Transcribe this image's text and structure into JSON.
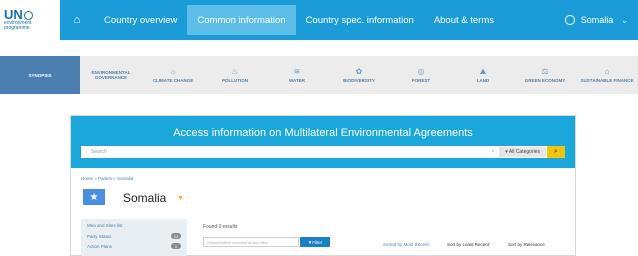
{
  "topnav": {
    "logo_text": "UN",
    "logo_sub_1": "environment",
    "logo_sub_2": "programme",
    "home_icon": "home-icon",
    "items": [
      {
        "label": "Country overview"
      },
      {
        "label": "Common information"
      },
      {
        "label": "Country spec. information"
      },
      {
        "label": "About & terms"
      }
    ],
    "active_index": 1,
    "country": "Somalia"
  },
  "subnav": {
    "items": [
      {
        "label": "SYNOPSIS",
        "icon": ""
      },
      {
        "label": "ENVIRONMENTAL GOVERNANCE",
        "icon": ""
      },
      {
        "label": "CLIMATE CHANGE",
        "icon": "☼"
      },
      {
        "label": "POLLUTION",
        "icon": "♨"
      },
      {
        "label": "WATER",
        "icon": "≋"
      },
      {
        "label": "BIODIVERSITY",
        "icon": "✿"
      },
      {
        "label": "FOREST",
        "icon": "◎"
      },
      {
        "label": "LAND",
        "icon": "⛰"
      },
      {
        "label": "GREEN ECONOMY",
        "icon": "⚖"
      },
      {
        "label": "SUSTAINABLE FINANCE",
        "icon": "⌂"
      }
    ]
  },
  "hero": {
    "title": "Access information on Multilateral Environmental Agreements",
    "search_placeholder": "Search",
    "category": "▾ All Categories",
    "search_icon": "search-icon"
  },
  "breadcrumb": "Home » Parties » Somalia",
  "country": {
    "name": "Somalia",
    "flag_star": "★"
  },
  "sidebar": {
    "title": "Mea and Sites list",
    "rows": [
      {
        "label": "Party Status",
        "count": "23"
      },
      {
        "label": "Action Plans",
        "count": "0"
      }
    ]
  },
  "results": {
    "found": "Found 0 results",
    "filter_placeholder": "Search within documents and files",
    "filter_label": "Filter",
    "sort_options": [
      "Sorted by Most Recent",
      "Sort by Least Recent",
      "Sort by Relevance"
    ]
  }
}
